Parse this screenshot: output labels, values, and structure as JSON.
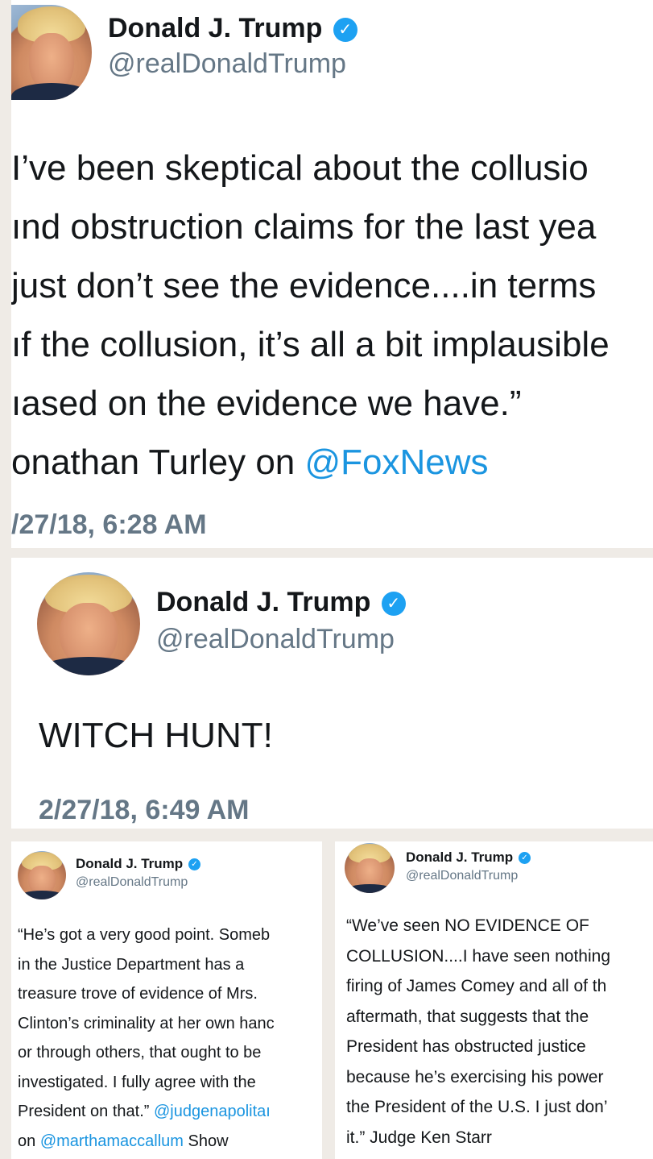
{
  "tweets": [
    {
      "name": "Donald J. Trump",
      "handle": "@realDonaldTrump",
      "lines": [
        "I’ve been skeptical about the collusio",
        "ınd obstruction claims for the last yea",
        "just don’t see the evidence....in terms",
        "ıf the collusion, it’s all a bit implausible",
        "ıased on the evidence we have.”"
      ],
      "last_prefix": "onathan Turley on ",
      "last_link": "@FoxNews",
      "timestamp": "/27/18, 6:28 AM"
    },
    {
      "name": "Donald J. Trump",
      "handle": "@realDonaldTrump",
      "body": "WITCH HUNT!",
      "timestamp": "2/27/18, 6:49 AM"
    },
    {
      "name": "Donald J. Trump",
      "handle": "@realDonaldTrump",
      "lines": [
        "“He’s got a very good point. Someb",
        "in the Justice Department has a",
        "treasure trove of evidence of Mrs.",
        "Clinton’s criminality at her own hanc",
        "or through others, that ought to be",
        "investigated. I fully agree with the"
      ],
      "line7_prefix": "President on that.” ",
      "line7_link": "@judgenapolitaı",
      "line8_prefix": "on ",
      "line8_link": "@marthamaccallum",
      "line8_suffix": " Show"
    },
    {
      "name": "Donald J. Trump",
      "handle": "@realDonaldTrump",
      "lines": [
        "“We’ve seen NO EVIDENCE OF",
        "COLLUSION....I have seen nothing",
        "firing of James Comey and all of th",
        "aftermath, that suggests that the",
        "President has obstructed justice",
        "because he’s exercising his power",
        "the President of the U.S. I just don’",
        "it.”  Judge Ken Starr"
      ]
    }
  ],
  "icons": {
    "verified": "verified-badge-icon",
    "avatar": "profile-photo"
  },
  "colors": {
    "link": "#1b95e0",
    "badge": "#1da1f2",
    "muted": "#657786"
  }
}
